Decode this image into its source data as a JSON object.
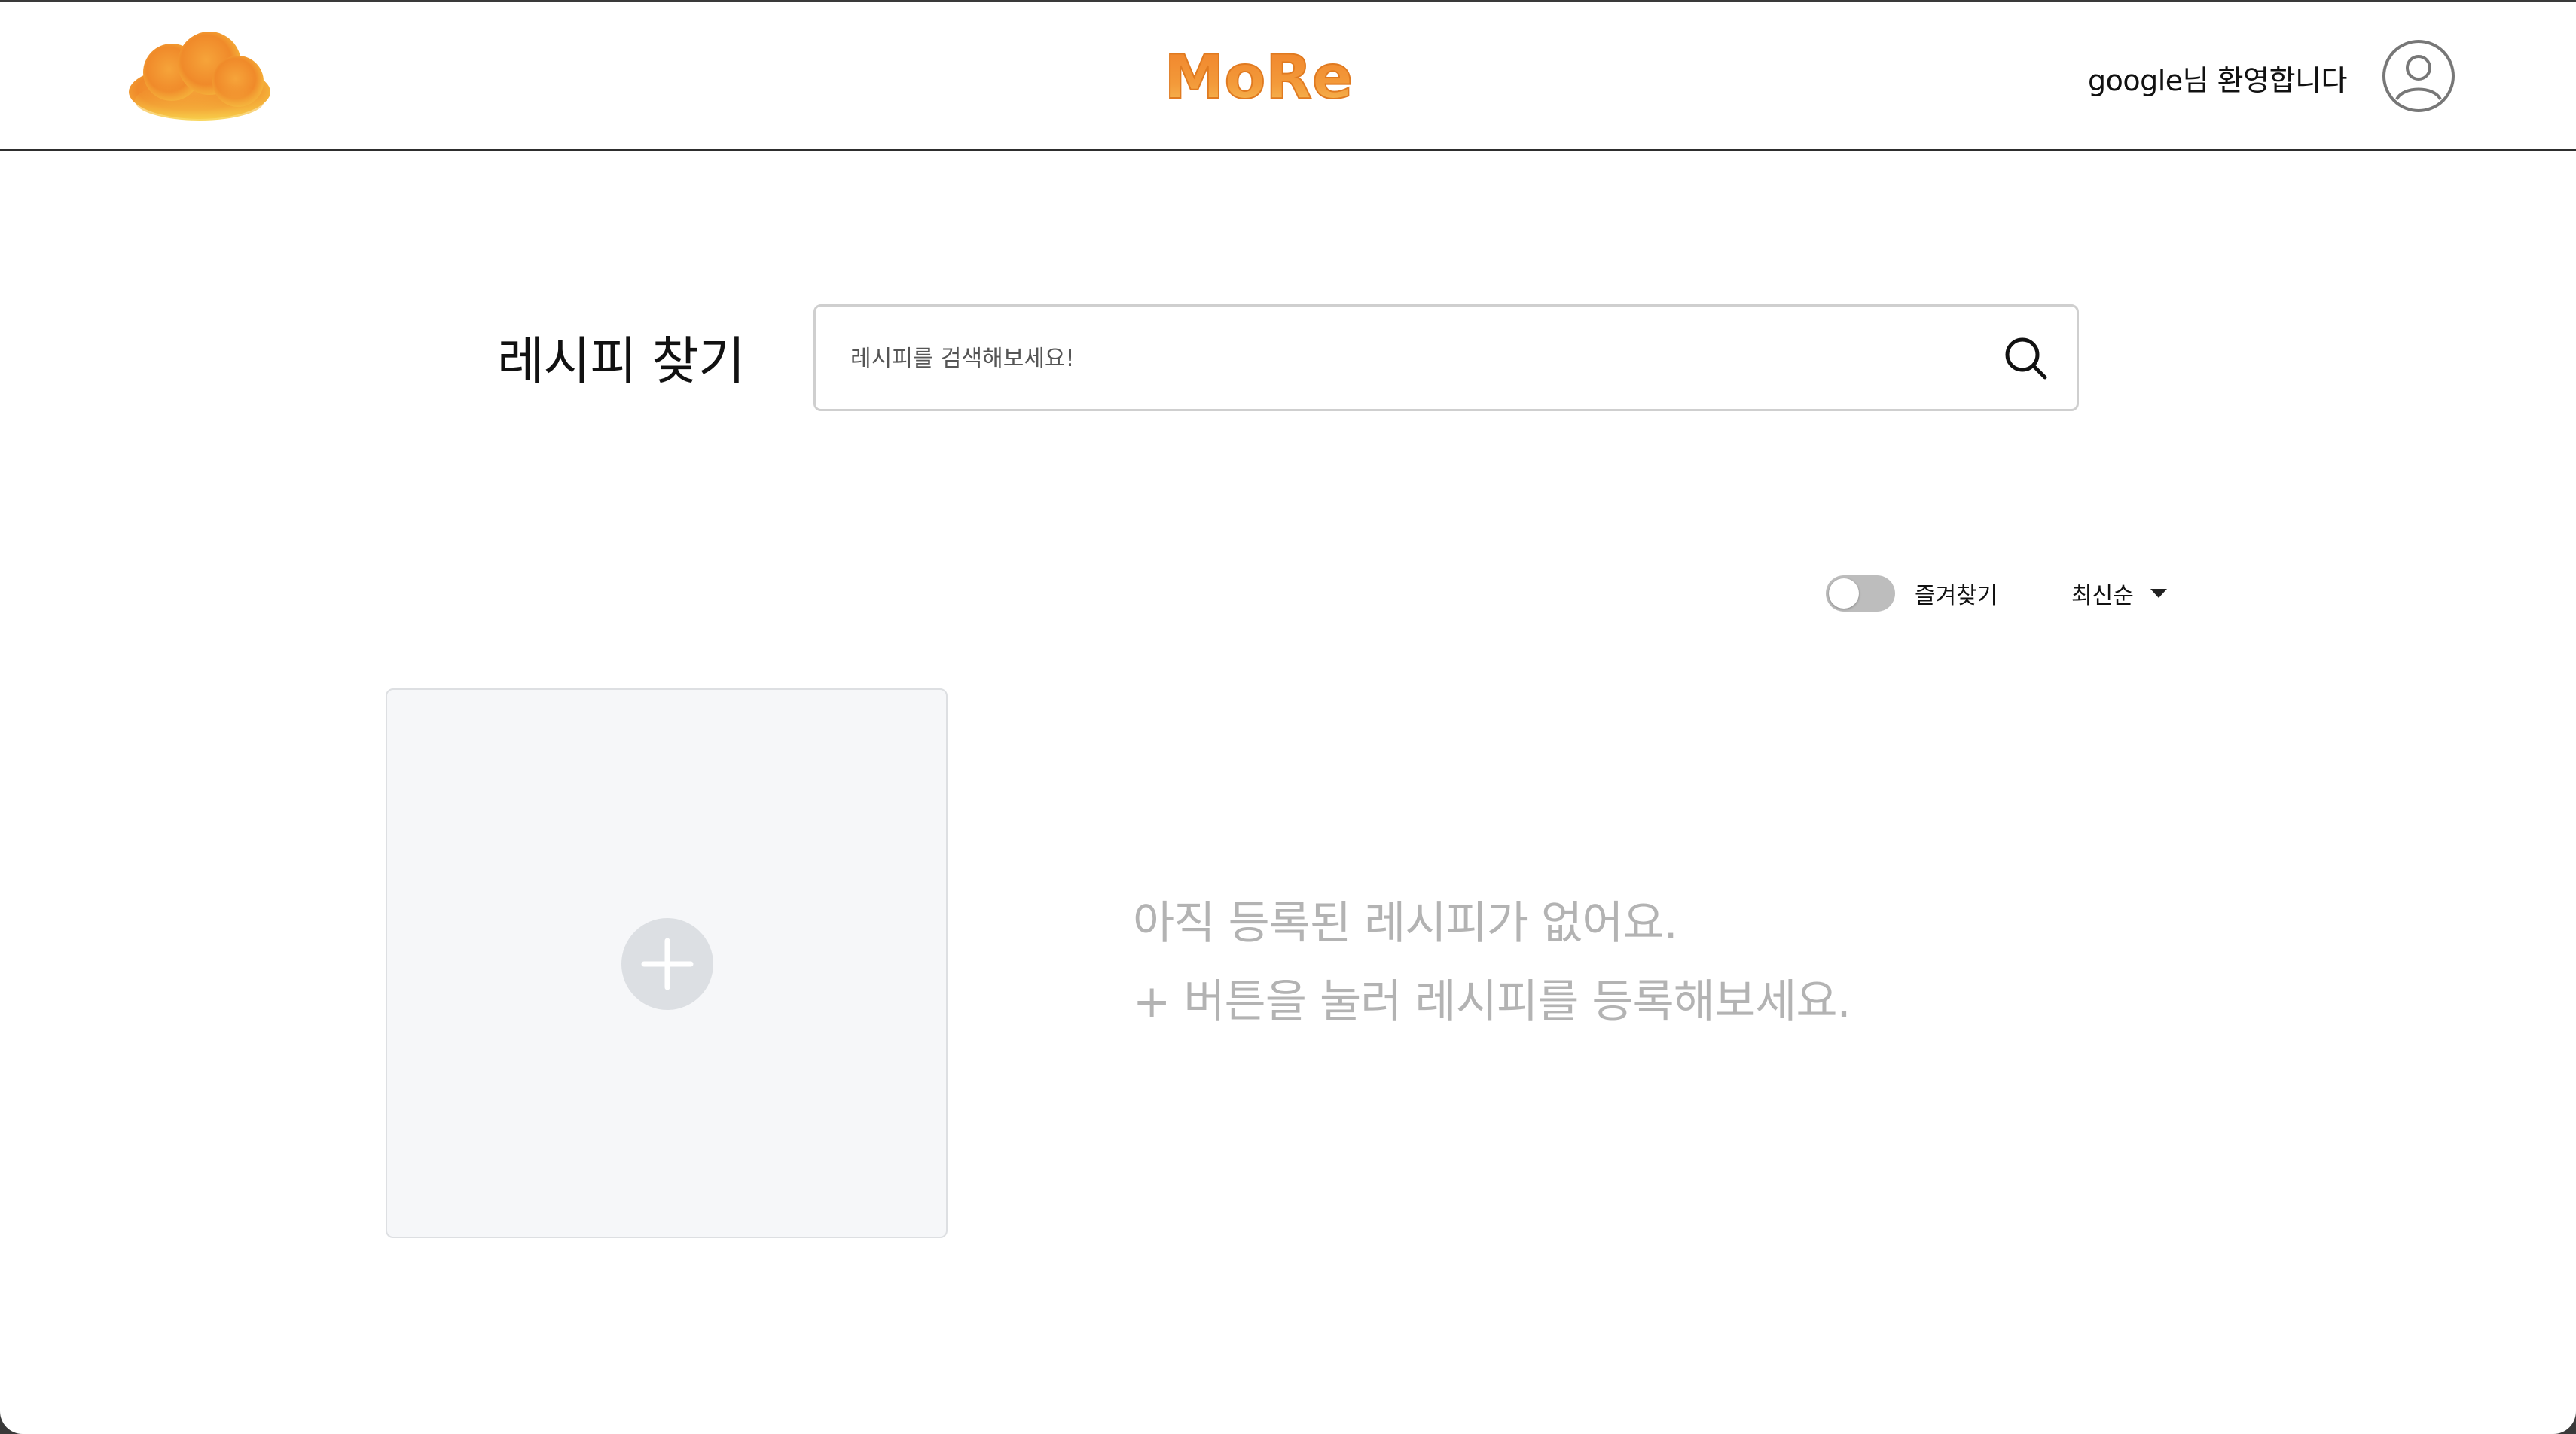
{
  "header": {
    "logo_icon": "cloud-logo-icon",
    "brand_name": "MoRe",
    "welcome_text": "google님 환영합니다",
    "avatar_icon": "user-avatar-icon"
  },
  "search": {
    "title": "레시피 찾기",
    "placeholder": "레시피를 검색해보세요!",
    "value": "",
    "icon": "search-icon"
  },
  "controls": {
    "favorites_label": "즐겨찾기",
    "favorites_on": false,
    "sort_selected": "최신순"
  },
  "content": {
    "add_icon": "plus-icon",
    "empty_line1": "아직 등록된 레시피가 없어요.",
    "empty_line2": "+ 버튼을 눌러 레시피를 등록해보세요."
  },
  "colors": {
    "brand_orange": "#f08a2a",
    "brand_yellow": "#f7c743",
    "toggle_off": "#bdbdbd",
    "muted_text": "#b3b3b3"
  }
}
